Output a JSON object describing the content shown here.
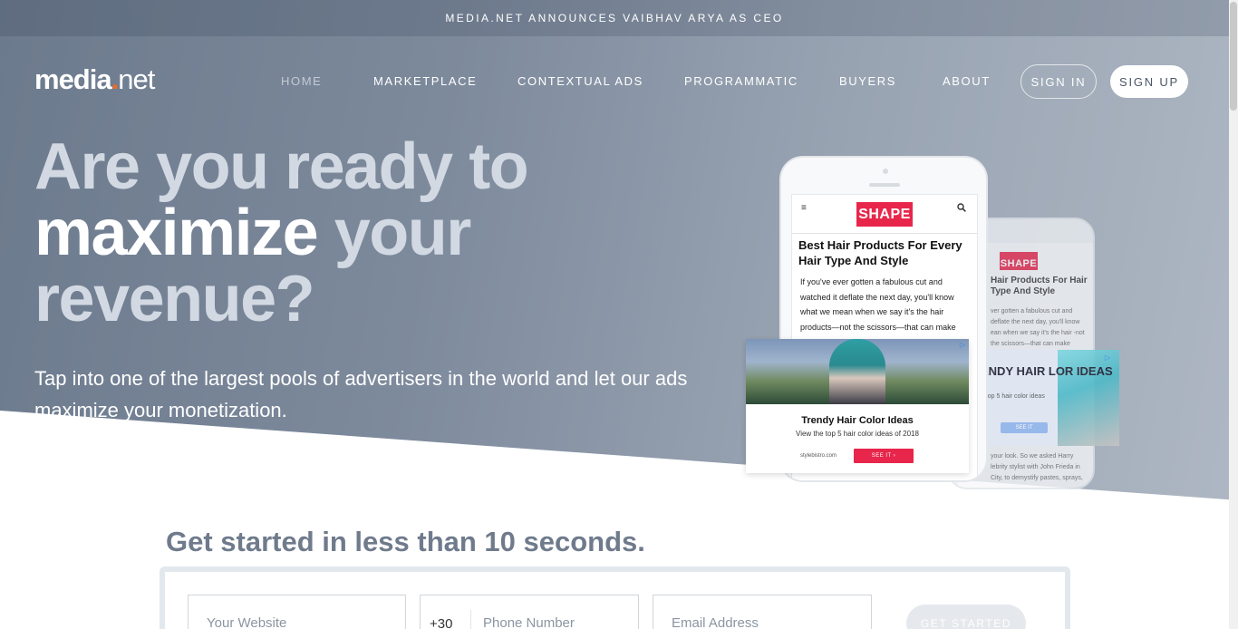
{
  "announcement": "MEDIA.NET ANNOUNCES VAIBHAV ARYA AS CEO",
  "logo": {
    "part1": "media",
    "dot": ".",
    "part2": "net"
  },
  "nav": {
    "items": [
      {
        "label": "HOME"
      },
      {
        "label": "MARKETPLACE"
      },
      {
        "label": "CONTEXTUAL ADS"
      },
      {
        "label": "PROGRAMMATIC"
      },
      {
        "label": "BUYERS"
      },
      {
        "label": "ABOUT"
      }
    ],
    "active": "HOME",
    "sign_in": "SIGN IN",
    "sign_up": "SIGN UP"
  },
  "hero": {
    "headline_line1": "Are you ready to",
    "headline_strong": "maximize",
    "headline_after": " your",
    "headline_line3": "revenue?",
    "subtext": "Tap into one of the largest pools of advertisers in the world and let our ads maximize your monetization."
  },
  "mockup": {
    "brand": "SHAPE",
    "article_title": "Best Hair Products For Every Hair Type And Style",
    "article_body": "If you've ever gotten a fabulous cut and watched it deflate the next day, you'll know what we mean when we say it's the hair products—not the scissors—that can make",
    "back_title": "Hair Products For Hair Type And Style",
    "back_body": "ver gotten a fabulous cut and deflate the next day, you'll know ean when we say it's the hair -not the scissors—that can make",
    "back_body2": "your look. So we asked Harry lebrity stylist with John Frieda in City, to demystify pastes, sprays,",
    "ad_title": "Trendy Hair Color Ideas",
    "ad_subtitle": "View the top 5 hair color ideas of 2018",
    "ad_domain": "stylebistro.com",
    "ad_cta": "SEE IT ›",
    "back_ad_title": "ENDY HAIR LOR IDEAS",
    "back_ad_sub": "e top 5 hair color ideas",
    "back_ad_cta": "SEE IT"
  },
  "signup_form": {
    "heading": "Get started in less than 10 seconds.",
    "website_placeholder": "Your Website",
    "phone_code": "+30",
    "phone_placeholder": "Phone Number",
    "email_placeholder": "Email Address",
    "submit": "GET STARTED"
  },
  "colors": {
    "accent_orange": "#f26b21",
    "shape_pink": "#e8264b",
    "heading_gray": "#6f7b8c"
  }
}
